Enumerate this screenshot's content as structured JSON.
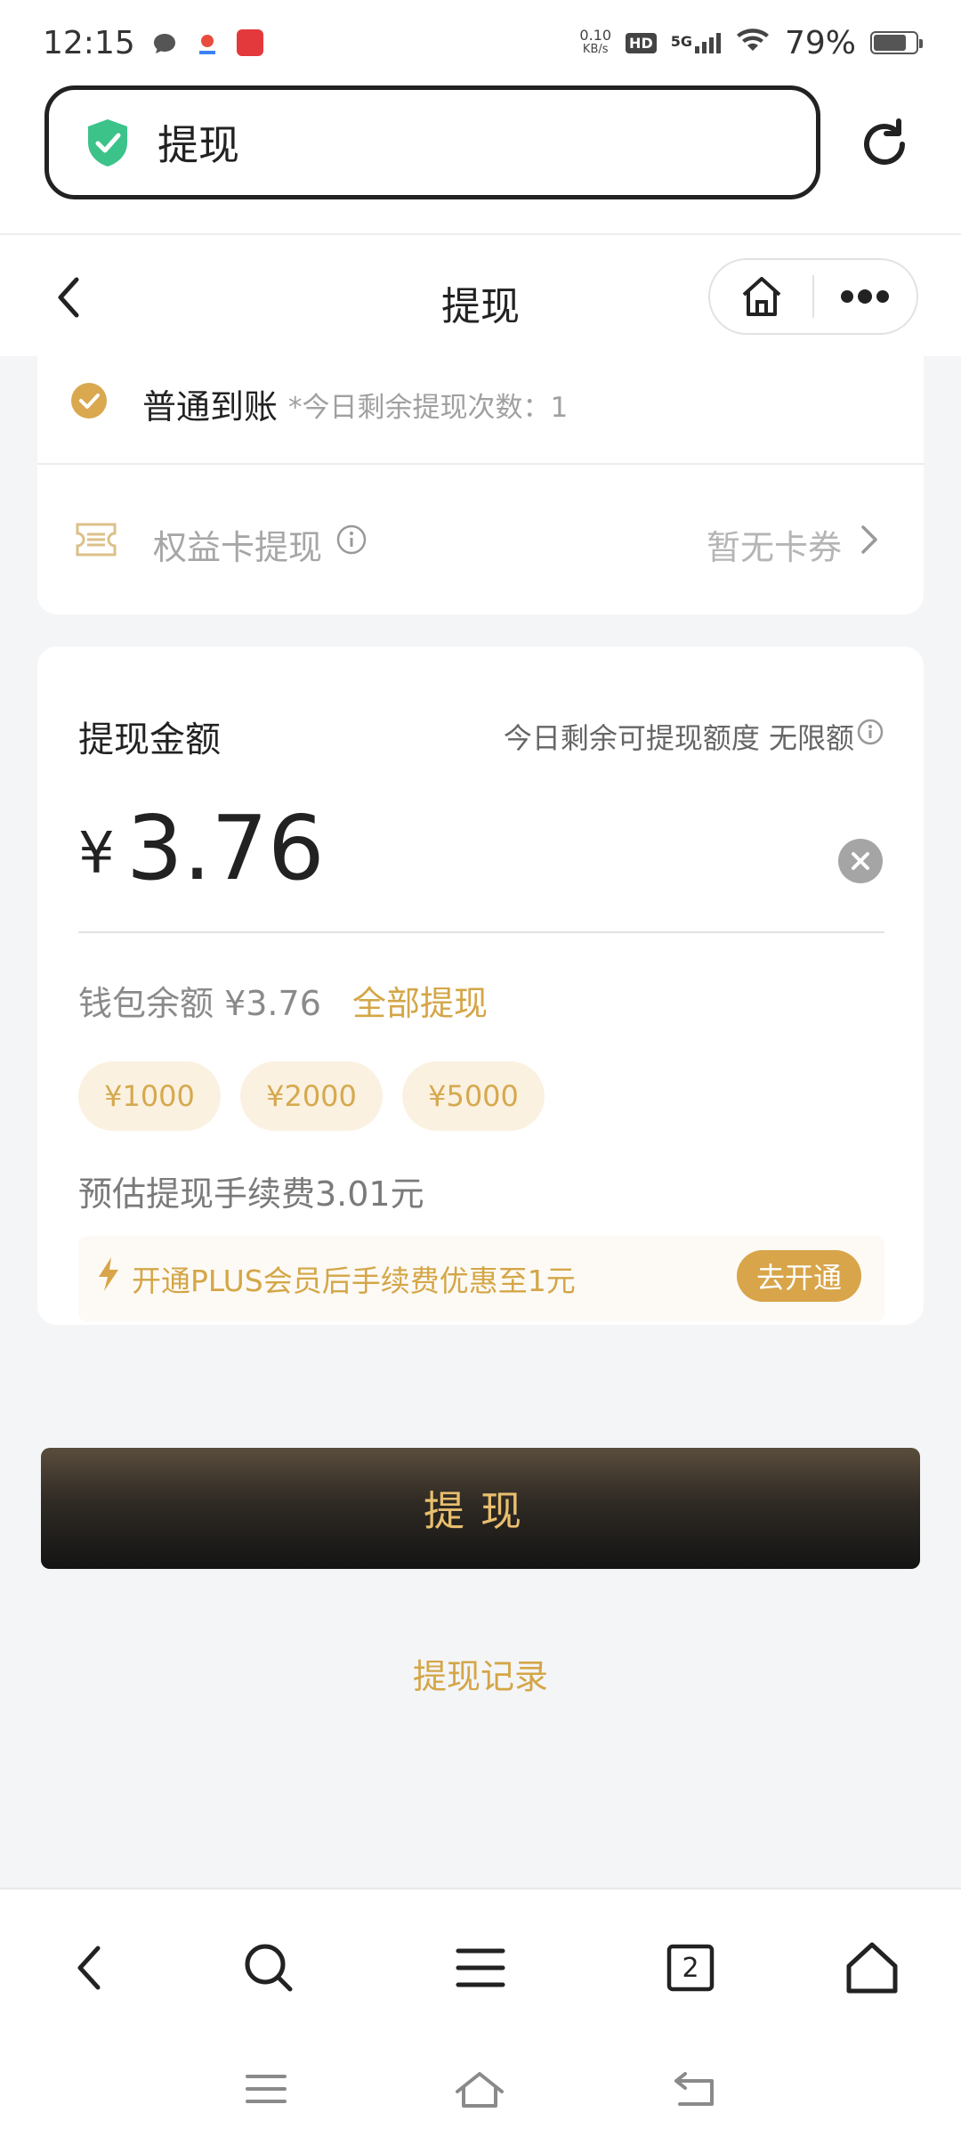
{
  "status_bar": {
    "time": "12:15",
    "net_speed_value": "0.10",
    "net_speed_unit": "KB/s",
    "hd_badge": "HD",
    "network": "5G",
    "battery": "79%",
    "battery_level": 0.79
  },
  "browser": {
    "url_title": "提现"
  },
  "header": {
    "title": "提现"
  },
  "arrival": {
    "label": "普通到账",
    "note": "*今日剩余提现次数：1"
  },
  "card_voucher": {
    "label": "权益卡提现",
    "status": "暂无卡券"
  },
  "amount_card": {
    "title": "提现金额",
    "limit": "今日剩余可提现额度 无限额",
    "currency": "¥",
    "value": "3.76",
    "balance": "钱包余额 ¥3.76",
    "withdraw_all": "全部提现",
    "chips": [
      "¥1000",
      "¥2000",
      "¥5000"
    ],
    "fee": "预估提现手续费3.01元",
    "promo": "开通PLUS会员后手续费优惠至1元",
    "promo_button": "去开通"
  },
  "actions": {
    "withdraw": "提现",
    "history": "提现记录"
  },
  "bottom_nav": {
    "tab_count": "2"
  },
  "colors": {
    "accent_gold": "#d4a647",
    "shield_green": "#3cc38a"
  }
}
